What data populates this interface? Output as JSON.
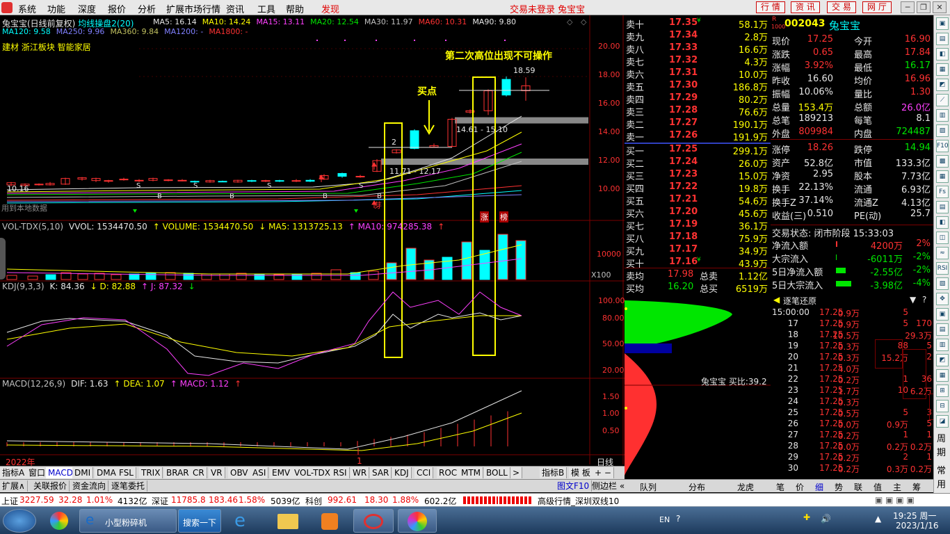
{
  "menu": {
    "items": [
      "系统",
      "功能",
      "深度",
      "报价",
      "分析",
      "扩展市场行情",
      "资讯",
      "工具",
      "帮助"
    ],
    "discover": "发现",
    "center": "交易未登录  兔宝宝",
    "right_buttons": [
      "行 情",
      "资 讯",
      "交 易",
      "网 厅"
    ]
  },
  "chart": {
    "title": "兔宝宝(日线前复权)",
    "indicator": "均线操盘2(20)",
    "ma_line1": [
      {
        "t": "MA5: 16.14",
        "c": "#e6e6e6"
      },
      {
        "t": "MA10: 14.24",
        "c": "#ffff00"
      },
      {
        "t": "MA15: 13.11",
        "c": "#ff40ff"
      },
      {
        "t": "MA20: 12.54",
        "c": "#00e600"
      },
      {
        "t": "MA30: 11.97",
        "c": "#c0c0c0"
      },
      {
        "t": "MA60: 10.31",
        "c": "#ff3232"
      },
      {
        "t": "MA90: 9.80",
        "c": "#e6e6e6"
      }
    ],
    "ma_line2": [
      {
        "t": "MA120: 9.58",
        "c": "#00ffff"
      },
      {
        "t": "MA250: 9.96",
        "c": "#8080ff"
      },
      {
        "t": "MA360: 9.84",
        "c": "#c0c060"
      },
      {
        "t": "MA1200: -",
        "c": "#8080ff"
      },
      {
        "t": "MA1800: -",
        "c": "#ff3232"
      }
    ],
    "sector": "建材 浙江板块 智能家居",
    "annot_title": "第二次高位出现不可操作",
    "annot_buy": "买点",
    "box_num": "2",
    "price_labels": [
      "20.00",
      "18.00",
      "16.00",
      "14.00",
      "12.00",
      "10.00"
    ],
    "label_hi": "18.59",
    "label_range": "14.61 - 15.10",
    "label_range2": "11.71 - 12.17",
    "label_lo": "10.16",
    "label_used": "用到本地数据",
    "label_ya": "芽",
    "label_zhang": "涨",
    "label_bang": "榜",
    "vol_hdr": [
      {
        "t": "VOL-TDX(5,10)",
        "c": "#c0c0c0"
      },
      {
        "t": "VVOL: 1534470.50",
        "c": "#e6e6e6"
      },
      {
        "t": "↑ VOLUME: 1534470.50",
        "c": "#ffff00"
      },
      {
        "t": "↓ MA5: 1313725.13",
        "c": "#ffff00"
      },
      {
        "t": "↑ MA10: 974285.38",
        "c": "#ff40ff"
      },
      {
        "t": "↑",
        "c": "#ff3232"
      }
    ],
    "vol_labels": [
      "10000",
      "X100"
    ],
    "kdj_hdr": [
      {
        "t": "KDJ(9,3,3)",
        "c": "#c0c0c0"
      },
      {
        "t": "K: 84.36",
        "c": "#e6e6e6"
      },
      {
        "t": "↓ D: 82.88",
        "c": "#ffff00"
      },
      {
        "t": "↑ J: 87.32",
        "c": "#ff40ff"
      },
      {
        "t": "↓",
        "c": "#00e600"
      }
    ],
    "kdj_labels": [
      "100.00",
      "80.00",
      "50.00",
      "20.00"
    ],
    "macd_hdr": [
      {
        "t": "MACD(12,26,9)",
        "c": "#c0c0c0"
      },
      {
        "t": "DIF: 1.63",
        "c": "#e6e6e6"
      },
      {
        "t": "↑ DEA: 1.07",
        "c": "#ffff00"
      },
      {
        "t": "↑ MACD: 1.12",
        "c": "#ff40ff"
      },
      {
        "t": "↑",
        "c": "#ff3232"
      }
    ],
    "macd_labels": [
      "1.50",
      "1.00",
      "0.50"
    ],
    "year": "2022年",
    "month": "1",
    "period": "日线"
  },
  "order_book": {
    "sells": [
      {
        "l": "卖十",
        "p": "17.35",
        "v": "58.1万",
        "m": "¥"
      },
      {
        "l": "卖九",
        "p": "17.34",
        "v": "2.8万"
      },
      {
        "l": "卖八",
        "p": "17.33",
        "v": "16.6万"
      },
      {
        "l": "卖七",
        "p": "17.32",
        "v": "4.3万"
      },
      {
        "l": "卖六",
        "p": "17.31",
        "v": "10.0万"
      },
      {
        "l": "卖五",
        "p": "17.30",
        "v": "186.8万"
      },
      {
        "l": "卖四",
        "p": "17.29",
        "v": "80.2万"
      },
      {
        "l": "卖三",
        "p": "17.28",
        "v": "76.6万"
      },
      {
        "l": "卖二",
        "p": "17.27",
        "v": "190.1万"
      },
      {
        "l": "卖一",
        "p": "17.26",
        "v": "191.9万"
      }
    ],
    "buys": [
      {
        "l": "买一",
        "p": "17.25",
        "v": "299.1万"
      },
      {
        "l": "买二",
        "p": "17.24",
        "v": "26.0万"
      },
      {
        "l": "买三",
        "p": "17.23",
        "v": "15.0万"
      },
      {
        "l": "买四",
        "p": "17.22",
        "v": "19.8万"
      },
      {
        "l": "买五",
        "p": "17.21",
        "v": "54.6万"
      },
      {
        "l": "买六",
        "p": "17.20",
        "v": "45.6万"
      },
      {
        "l": "买七",
        "p": "17.19",
        "v": "36.1万"
      },
      {
        "l": "买八",
        "p": "17.18",
        "v": "75.9万"
      },
      {
        "l": "买九",
        "p": "17.17",
        "v": "34.9万"
      },
      {
        "l": "买十",
        "p": "17.16",
        "v": "43.9万",
        "m": "¥"
      }
    ],
    "avg_sell": {
      "l": "卖均",
      "p": "17.98",
      "k": "总卖",
      "v": "1.12亿"
    },
    "avg_buy": {
      "l": "买均",
      "p": "16.20",
      "k": "总买",
      "v": "6519万"
    },
    "dist_label": "兔宝宝 买比:39.2"
  },
  "stock": {
    "code": "002043",
    "name": "兔宝宝",
    "tag_r": "R",
    "tag_1000": "1000",
    "rows": [
      [
        {
          "t": "现价",
          "c": "wht"
        },
        {
          "t": "17.25",
          "c": "red"
        },
        {
          "t": "今开",
          "c": "wht"
        },
        {
          "t": "16.90",
          "c": "red"
        }
      ],
      [
        {
          "t": "涨跌",
          "c": "wht"
        },
        {
          "t": "0.65",
          "c": "red"
        },
        {
          "t": "最高",
          "c": "wht"
        },
        {
          "t": "17.84",
          "c": "red"
        }
      ],
      [
        {
          "t": "涨幅",
          "c": "wht"
        },
        {
          "t": "3.92%",
          "c": "red"
        },
        {
          "t": "最低",
          "c": "wht"
        },
        {
          "t": "16.17",
          "c": "grn"
        }
      ],
      [
        {
          "t": "昨收",
          "c": "wht"
        },
        {
          "t": "16.60",
          "c": "wht"
        },
        {
          "t": "均价",
          "c": "wht"
        },
        {
          "t": "16.96",
          "c": "red"
        }
      ],
      [
        {
          "t": "振幅",
          "c": "wht"
        },
        {
          "t": "10.06%",
          "c": "wht"
        },
        {
          "t": "量比",
          "c": "wht"
        },
        {
          "t": "1.30",
          "c": "red"
        }
      ],
      [
        {
          "t": "总量",
          "c": "wht"
        },
        {
          "t": "153.4万",
          "c": "yel"
        },
        {
          "t": "总额",
          "c": "wht"
        },
        {
          "t": "26.0亿",
          "c": "mag"
        }
      ],
      [
        {
          "t": "总笔",
          "c": "wht"
        },
        {
          "t": "189213",
          "c": "wht"
        },
        {
          "t": "每笔",
          "c": "wht"
        },
        {
          "t": "8.1",
          "c": "wht"
        }
      ],
      [
        {
          "t": "外盘",
          "c": "wht"
        },
        {
          "t": "809984",
          "c": "red"
        },
        {
          "t": "内盘",
          "c": "wht"
        },
        {
          "t": "724487",
          "c": "grn"
        }
      ],
      [
        {
          "t": "涨停",
          "c": "wht"
        },
        {
          "t": "18.26",
          "c": "red"
        },
        {
          "t": "跌停",
          "c": "wht"
        },
        {
          "t": "14.94",
          "c": "grn"
        }
      ],
      [
        {
          "t": "资产",
          "c": "wht"
        },
        {
          "t": "52.8亿",
          "c": "wht"
        },
        {
          "t": "市值",
          "c": "wht"
        },
        {
          "t": "133.3亿",
          "c": "wht"
        }
      ],
      [
        {
          "t": "净资",
          "c": "wht"
        },
        {
          "t": "2.95",
          "c": "wht"
        },
        {
          "t": "股本",
          "c": "wht"
        },
        {
          "t": "7.73亿",
          "c": "wht"
        }
      ],
      [
        {
          "t": "换手",
          "c": "wht"
        },
        {
          "t": "22.13%",
          "c": "wht"
        },
        {
          "t": "流通",
          "c": "wht"
        },
        {
          "t": "6.93亿",
          "c": "wht"
        }
      ],
      [
        {
          "t": "换手Z",
          "c": "wht"
        },
        {
          "t": "37.14%",
          "c": "wht"
        },
        {
          "t": "流通Z",
          "c": "wht"
        },
        {
          "t": "4.13亿",
          "c": "wht"
        }
      ],
      [
        {
          "t": "收益(三)",
          "c": "wht"
        },
        {
          "t": "0.510",
          "c": "wht"
        },
        {
          "t": "PE(动)",
          "c": "wht"
        },
        {
          "t": "25.7",
          "c": "wht"
        }
      ]
    ],
    "trade_state": "交易状态: 闭市阶段 15:33:03",
    "flows": [
      {
        "k": "净流入额",
        "v": "4200万",
        "p": "2%",
        "c": "red"
      },
      {
        "k": "大宗流入",
        "v": "-6011万",
        "p": "-2%",
        "c": "grn"
      },
      {
        "k": "5日净流入额",
        "v": "-2.55亿",
        "p": "-2%",
        "c": "grn"
      },
      {
        "k": "5日大宗流入",
        "v": "-3.98亿",
        "p": "-4%",
        "c": "grn"
      }
    ]
  },
  "ticks": {
    "title": "逐笔还原",
    "rows": [
      [
        "15:00:00",
        "17.25",
        "0.9万",
        "5",
        ""
      ],
      [
        "17",
        "17.25",
        "0.9万",
        "5",
        "170"
      ],
      [
        "18",
        "17.25",
        "10.5万",
        "",
        "29.3万"
      ],
      [
        "19",
        "17.25",
        "0.3万",
        "88",
        "5"
      ],
      [
        "20",
        "17.25",
        "0.3万",
        "15.2万",
        "2"
      ],
      [
        "21",
        "17.25",
        "4.0万",
        "",
        ""
      ],
      [
        "22",
        "17.25",
        "0.2万",
        "1",
        "36"
      ],
      [
        "23",
        "17.25",
        "1.7万",
        "10",
        "6.2万"
      ],
      [
        "24",
        "17.25",
        "0.3万",
        "",
        ""
      ],
      [
        "25",
        "17.25",
        "0.5万",
        "5",
        "3"
      ],
      [
        "26",
        "17.25",
        "0.0万",
        "0.9万",
        "5"
      ],
      [
        "27",
        "17.25",
        "0.2万",
        "1",
        "1"
      ],
      [
        "28",
        "17.25",
        "0.0万",
        "0.2万",
        "0.2万"
      ],
      [
        "29",
        "17.25",
        "0.2万",
        "2",
        "1"
      ],
      [
        "30",
        "17.25",
        "0.2万",
        "0.3万",
        "0.2万"
      ]
    ]
  },
  "tabs1": [
    "指标A",
    "窗口",
    "MACD",
    "DMI",
    "DMA",
    "FSL",
    "TRIX",
    "BRAR",
    "CR",
    "VR",
    "OBV",
    "ASI",
    "EMV",
    "VOL-TDX",
    "RSI",
    "WR",
    "SAR",
    "KDJ",
    "CCI",
    "ROC",
    "MTM",
    "BOLL",
    ">",
    "指标B",
    "模 板"
  ],
  "tabs2": [
    "扩展∧",
    "关联报价",
    "资金流向",
    "逐笔委托"
  ],
  "tabs2_right": [
    "图文F10",
    "侧边栏 «"
  ],
  "rtabs": [
    "队列",
    "分布",
    "龙虎",
    "笔",
    "价",
    "细",
    "势",
    "联",
    "值",
    "主",
    "筹"
  ],
  "status": {
    "sh_name": "上证",
    "sh_val": "3227.59",
    "sh_chg": "32.28",
    "sh_pct": "1.01%",
    "sh_amt": "4132亿",
    "sz_name": "深证",
    "sz_val": "11785.8",
    "sz_chg": "183.46",
    "sz_pct": "1.58%",
    "sz_amt": "5039亿",
    "kc_name": "科创",
    "kc_val": "992.61",
    "kc_chg": "18.30",
    "kc_pct": "1.88%",
    "kc_amt": "602.2亿",
    "server": "高级行情_深圳双线10"
  },
  "rtool": {
    "chars": [
      "周",
      "期",
      "常",
      "用"
    ]
  },
  "taskbar": {
    "app1": "小型粉碎机",
    "search": "搜索一下",
    "lang": "EN",
    "time": "19:25 周一",
    "date": "2023/1/16"
  }
}
